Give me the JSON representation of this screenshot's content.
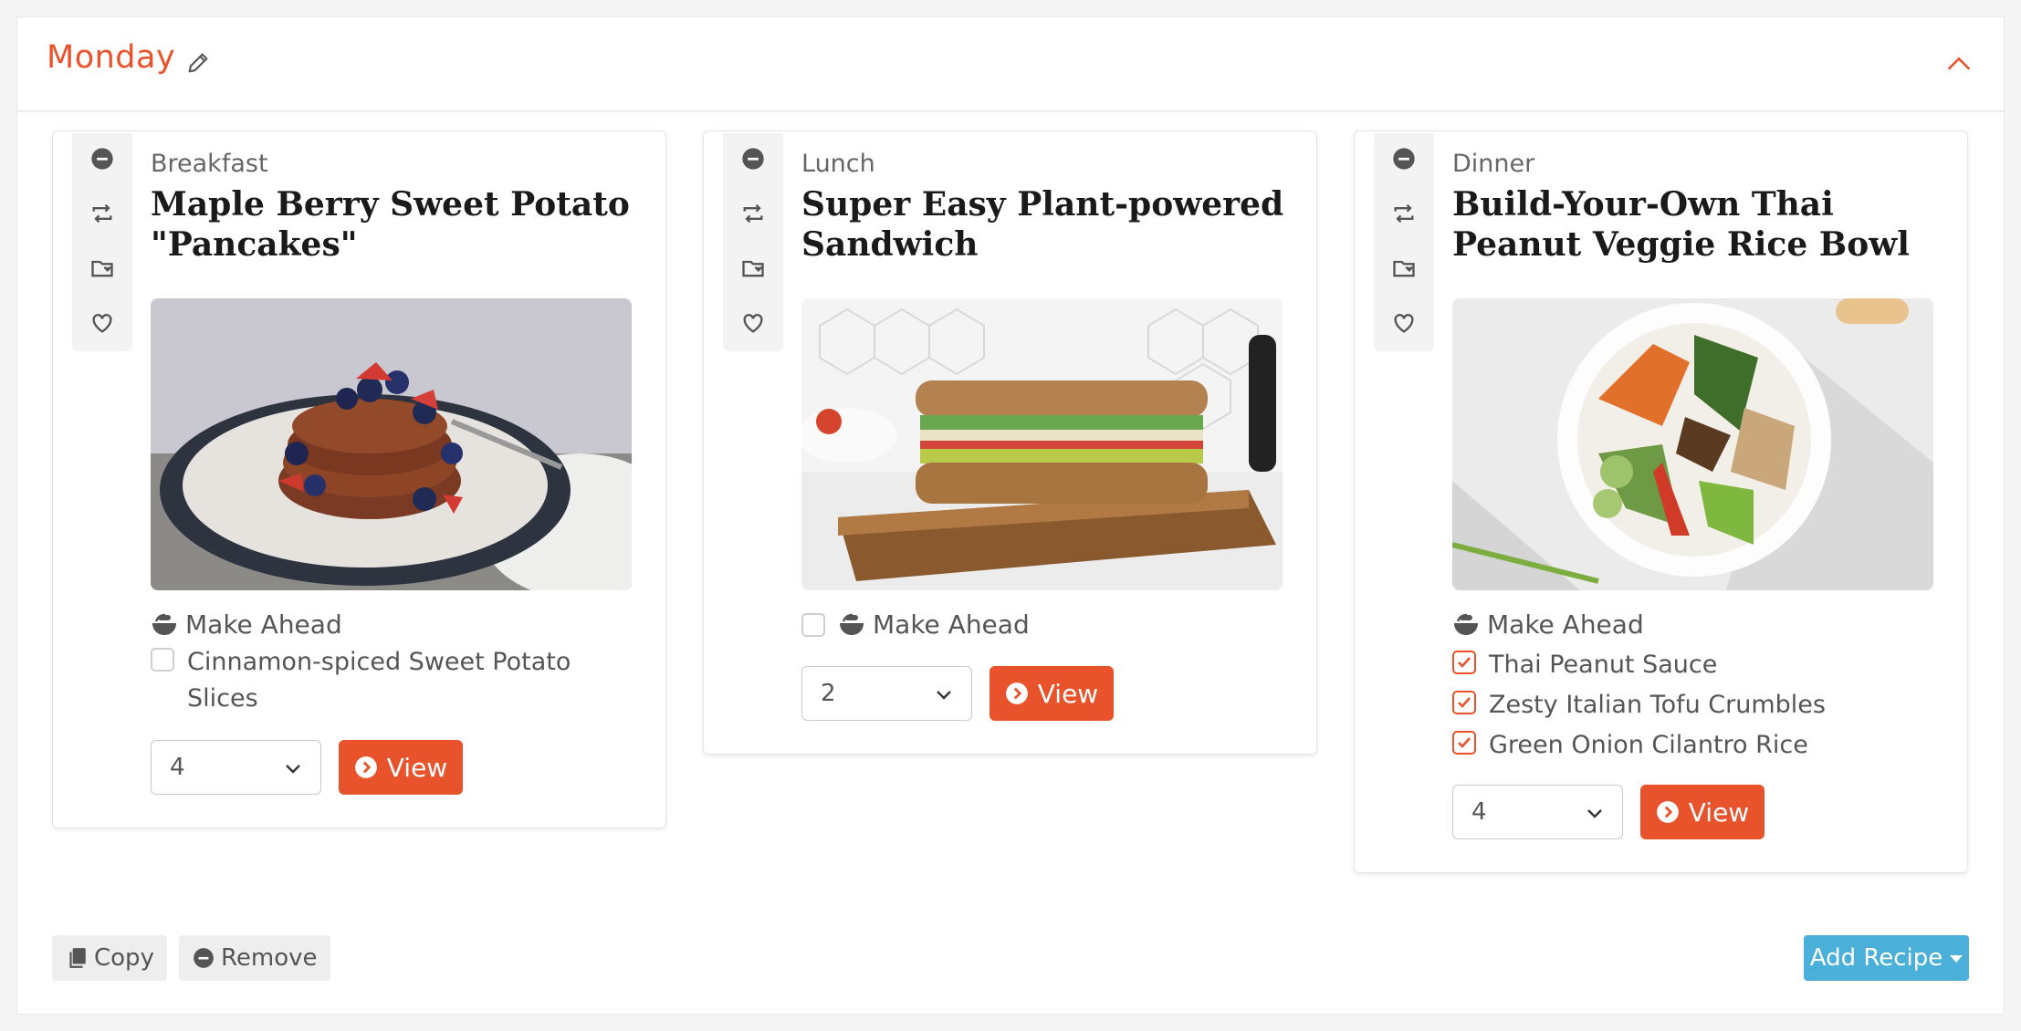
{
  "day": {
    "title": "Monday"
  },
  "meals": [
    {
      "type": "Breakfast",
      "title": "Maple Berry Sweet Potato \"Pancakes\"",
      "make_ahead_label": "Make Ahead",
      "make_ahead_items": [
        {
          "label": "Cinnamon-spiced Sweet Potato Slices",
          "checked": false
        }
      ],
      "servings": "4",
      "view_label": "View"
    },
    {
      "type": "Lunch",
      "title": "Super Easy Plant-powered Sandwich",
      "make_ahead_label": "Make Ahead",
      "make_ahead_checked": false,
      "servings": "2",
      "view_label": "View"
    },
    {
      "type": "Dinner",
      "title": "Build-Your-Own Thai Peanut Veggie Rice Bowl",
      "make_ahead_label": "Make Ahead",
      "make_ahead_items": [
        {
          "label": "Thai Peanut Sauce",
          "checked": true
        },
        {
          "label": "Zesty Italian Tofu Crumbles",
          "checked": true
        },
        {
          "label": "Green Onion Cilantro Rice",
          "checked": true
        }
      ],
      "servings": "4",
      "view_label": "View"
    }
  ],
  "footer": {
    "copy_label": "Copy",
    "remove_label": "Remove",
    "add_recipe_label": "Add Recipe"
  },
  "colors": {
    "accent": "#e8532b",
    "info": "#4ab0d9"
  },
  "icons": [
    "pencil-icon",
    "chevron-up-icon",
    "minus-circle-icon",
    "swap-icon",
    "folder-icon",
    "heart-icon",
    "bowl-icon",
    "play-circle-icon",
    "copy-icon",
    "caret-down-icon"
  ]
}
